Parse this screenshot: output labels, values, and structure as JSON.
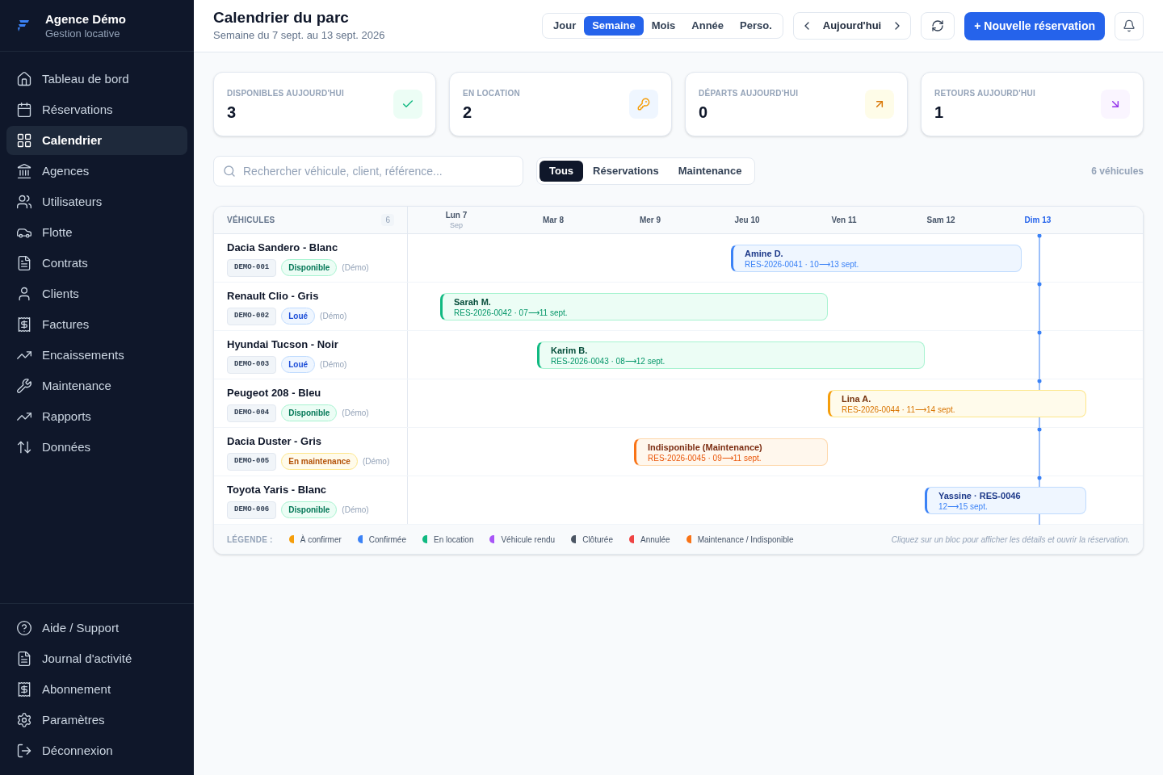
{
  "brand": {
    "name": "Agence Démo",
    "subtitle": "Gestion locative"
  },
  "sidebar": {
    "items": [
      {
        "label": "Tableau de bord",
        "selected": false
      },
      {
        "label": "Réservations",
        "selected": false
      },
      {
        "label": "Calendrier",
        "selected": true
      },
      {
        "label": "Agences",
        "selected": false
      },
      {
        "label": "Utilisateurs",
        "selected": false
      },
      {
        "label": "Flotte",
        "selected": false
      },
      {
        "label": "Contrats",
        "selected": false
      },
      {
        "label": "Clients",
        "selected": false
      },
      {
        "label": "Factures",
        "selected": false
      },
      {
        "label": "Encaissements",
        "selected": false
      },
      {
        "label": "Maintenance",
        "selected": false
      },
      {
        "label": "Rapports",
        "selected": false
      },
      {
        "label": "Données",
        "selected": false
      }
    ],
    "footer_items": [
      "Aide / Support",
      "Journal d'activité",
      "Abonnement",
      "Paramètres",
      "Déconnexion"
    ]
  },
  "header": {
    "title": "Calendrier du parc",
    "subtitle": "Semaine du 7 sept. au 13 sept. 2026",
    "views": [
      {
        "label": "Jour",
        "selected": false
      },
      {
        "label": "Semaine",
        "selected": true
      },
      {
        "label": "Mois",
        "selected": false
      },
      {
        "label": "Année",
        "selected": false
      },
      {
        "label": "Perso.",
        "selected": false
      }
    ],
    "today_button": "Aujourd'hui",
    "new_button": "+ Nouvelle réservation"
  },
  "stats": [
    {
      "label": "DISPONIBLES AUJOURD'HUI",
      "value": "3",
      "kind": "check"
    },
    {
      "label": "EN LOCATION",
      "value": "2",
      "kind": "key"
    },
    {
      "label": "DÉPARTS AUJOURD'HUI",
      "value": "0",
      "kind": "departure"
    },
    {
      "label": "RETOURS AUJOURD'HUI",
      "value": "1",
      "kind": "return"
    }
  ],
  "search": {
    "placeholder": "Rechercher véhicule, client, référence..."
  },
  "filters": [
    {
      "label": "Tous",
      "selected": true
    },
    {
      "label": "Réservations",
      "selected": false
    },
    {
      "label": "Maintenance",
      "selected": false
    }
  ],
  "vehicle_count": "6 véhicules",
  "calendar": {
    "vehicles_heading": "VÉHICULES",
    "vehicles_count": "6",
    "days": [
      {
        "label": "Lun 7",
        "month": "Sep",
        "today": false
      },
      {
        "label": "Mar 8",
        "today": false
      },
      {
        "label": "Mer 9",
        "today": false
      },
      {
        "label": "Jeu 10",
        "today": false
      },
      {
        "label": "Ven 11",
        "today": false
      },
      {
        "label": "Sam 12",
        "today": false
      },
      {
        "label": "Dim 13",
        "today": true
      }
    ],
    "rows": [
      {
        "name": "Dacia Sandero - Blanc",
        "plate": "DEMO-001",
        "status": {
          "text": "Disponible",
          "kind": "available"
        },
        "note": "(Démo)",
        "booking": {
          "title": "Amine D.",
          "detail": "RES-2026-0041 · 10⟶13 sept.",
          "kind": "confirmed"
        }
      },
      {
        "name": "Renault Clio - Gris",
        "plate": "DEMO-002",
        "status": {
          "text": "Loué",
          "kind": "rented"
        },
        "note": "(Démo)",
        "booking": {
          "title": "Sarah M.",
          "detail": "RES-2026-0042 · 07⟶11 sept.",
          "kind": "rental"
        }
      },
      {
        "name": "Hyundai Tucson - Noir",
        "plate": "DEMO-003",
        "status": {
          "text": "Loué",
          "kind": "rented"
        },
        "note": "(Démo)",
        "booking": {
          "title": "Karim B.",
          "detail": "RES-2026-0043 · 08⟶12 sept.",
          "kind": "rental"
        }
      },
      {
        "name": "Peugeot 208 - Bleu",
        "plate": "DEMO-004",
        "status": {
          "text": "Disponible",
          "kind": "available"
        },
        "note": "(Démo)",
        "booking": {
          "title": "Lina A.",
          "detail": "RES-2026-0044 · 11⟶14 sept.",
          "kind": "pending"
        }
      },
      {
        "name": "Dacia Duster - Gris",
        "plate": "DEMO-005",
        "status": {
          "text": "En maintenance",
          "kind": "maintenance"
        },
        "note": "(Démo)",
        "booking": {
          "title": "Indisponible (Maintenance)",
          "detail": "RES-2026-0045 · 09⟶11 sept.",
          "kind": "maintenance"
        }
      },
      {
        "name": "Toyota Yaris - Blanc",
        "plate": "DEMO-006",
        "status": {
          "text": "Disponible",
          "kind": "available"
        },
        "note": "(Démo)",
        "booking": {
          "title": "Yassine · RES-0046",
          "detail": "12⟶15 sept.",
          "kind": "confirmed"
        }
      }
    ]
  },
  "legend": {
    "label": "LÉGENDE :",
    "items": [
      {
        "label": "À confirmer",
        "color": "#f59e0b"
      },
      {
        "label": "Confirmée",
        "color": "#3b82f6"
      },
      {
        "label": "En location",
        "color": "#10b981"
      },
      {
        "label": "Véhicule rendu",
        "color": "#a855f7"
      },
      {
        "label": "Clôturée",
        "color": "#4b5563"
      },
      {
        "label": "Annulée",
        "color": "#ef4444"
      },
      {
        "label": "Maintenance / Indisponible",
        "color": "#f97316"
      }
    ],
    "hint": "Cliquez sur un bloc pour afficher les détails et ouvrir la réservation."
  }
}
